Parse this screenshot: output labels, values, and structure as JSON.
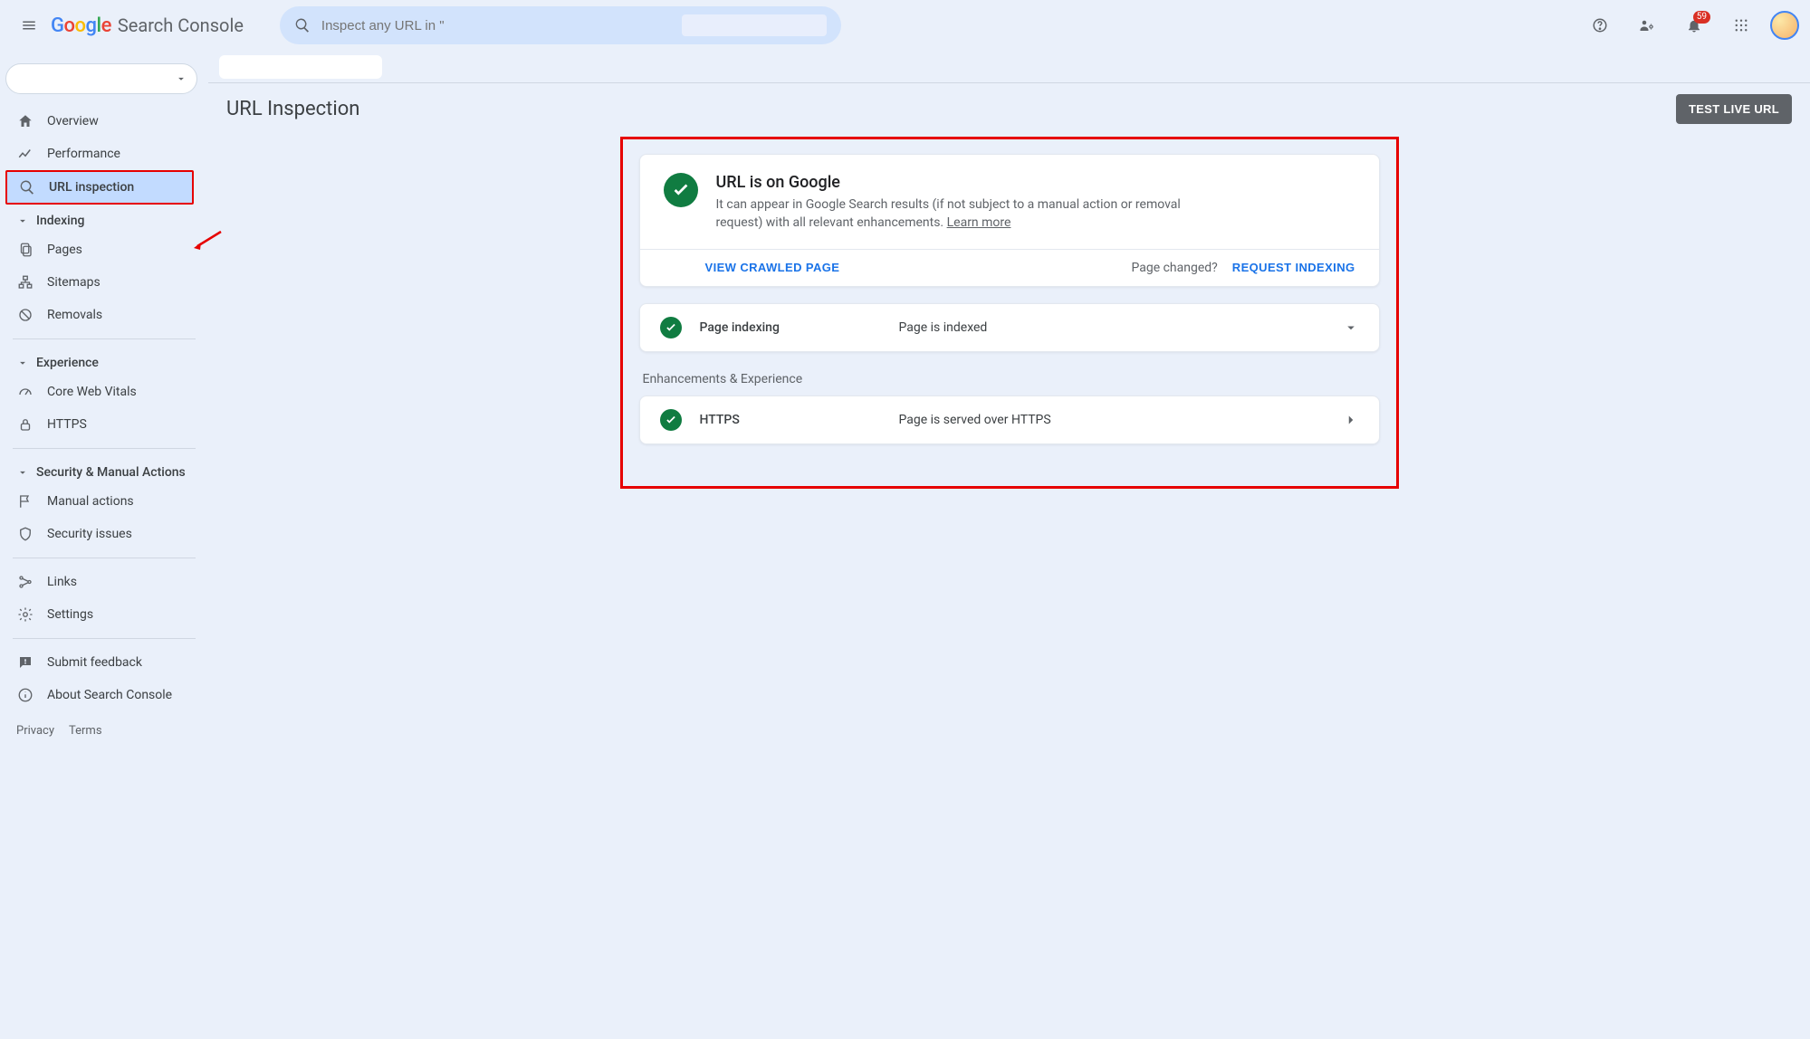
{
  "header": {
    "app_name": "Search Console",
    "search_placeholder": "Inspect any URL in \"",
    "notification_count": "59"
  },
  "sidebar": {
    "items": [
      {
        "label": "Overview"
      },
      {
        "label": "Performance"
      },
      {
        "label": "URL inspection"
      }
    ],
    "section_indexing": "Indexing",
    "indexing_items": [
      {
        "label": "Pages"
      },
      {
        "label": "Sitemaps"
      },
      {
        "label": "Removals"
      }
    ],
    "section_experience": "Experience",
    "experience_items": [
      {
        "label": "Core Web Vitals"
      },
      {
        "label": "HTTPS"
      }
    ],
    "section_security": "Security & Manual Actions",
    "security_items": [
      {
        "label": "Manual actions"
      },
      {
        "label": "Security issues"
      }
    ],
    "bottom_items": [
      {
        "label": "Links"
      },
      {
        "label": "Settings"
      }
    ],
    "feedback": "Submit feedback",
    "about": "About Search Console",
    "privacy": "Privacy",
    "terms": "Terms"
  },
  "main": {
    "page_title": "URL Inspection",
    "test_live_btn": "TEST LIVE URL",
    "status_title": "URL is on Google",
    "status_desc": "It can appear in Google Search results (if not subject to a manual action or removal request) with all relevant enhancements. ",
    "learn_more": "Learn more",
    "view_crawled": "VIEW CRAWLED PAGE",
    "page_changed": "Page changed?",
    "request_indexing": "REQUEST INDEXING",
    "row_indexing_label": "Page indexing",
    "row_indexing_value": "Page is indexed",
    "section_enh": "Enhancements & Experience",
    "row_https_label": "HTTPS",
    "row_https_value": "Page is served over HTTPS"
  }
}
